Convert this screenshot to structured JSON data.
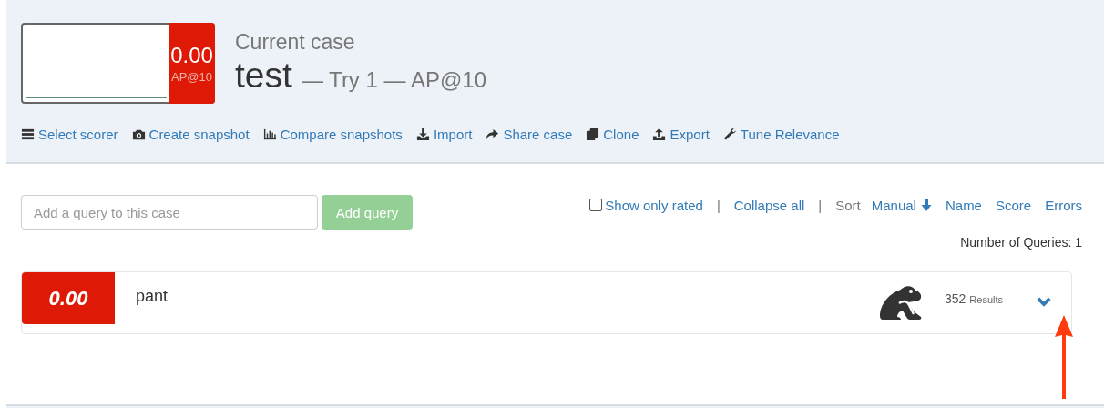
{
  "case_header": {
    "score": {
      "value": "0.00",
      "label": "AP@10"
    },
    "heading": "Current case",
    "name": "test",
    "detail": "— Try 1 — AP@10"
  },
  "toolbar": [
    {
      "label": "Select scorer"
    },
    {
      "label": "Create snapshot"
    },
    {
      "label": "Compare snapshots"
    },
    {
      "label": "Import"
    },
    {
      "label": "Share case"
    },
    {
      "label": "Clone"
    },
    {
      "label": "Export"
    },
    {
      "label": "Tune Relevance"
    }
  ],
  "query_input": {
    "placeholder": "Add a query to this case",
    "button": "Add query"
  },
  "list_controls": [
    {
      "kind": "checkbox",
      "label": "Show only rated",
      "checked": false
    },
    {
      "kind": "separator",
      "text": "|"
    },
    {
      "kind": "link",
      "label": "Collapse all"
    },
    {
      "kind": "separator",
      "text": "|"
    },
    {
      "kind": "label",
      "text": "Sort"
    },
    {
      "kind": "sort",
      "label": "Manual",
      "selected": true
    },
    {
      "kind": "sort",
      "label": "Name",
      "selected": false
    },
    {
      "kind": "sort",
      "label": "Score",
      "selected": false
    },
    {
      "kind": "sort",
      "label": "Errors",
      "selected": false
    }
  ],
  "query_count": "Number of Queries: 1",
  "queries": [
    {
      "score": "0.00",
      "text": "pant",
      "results_count": "352",
      "results_label": "Results",
      "expanded": false
    }
  ]
}
